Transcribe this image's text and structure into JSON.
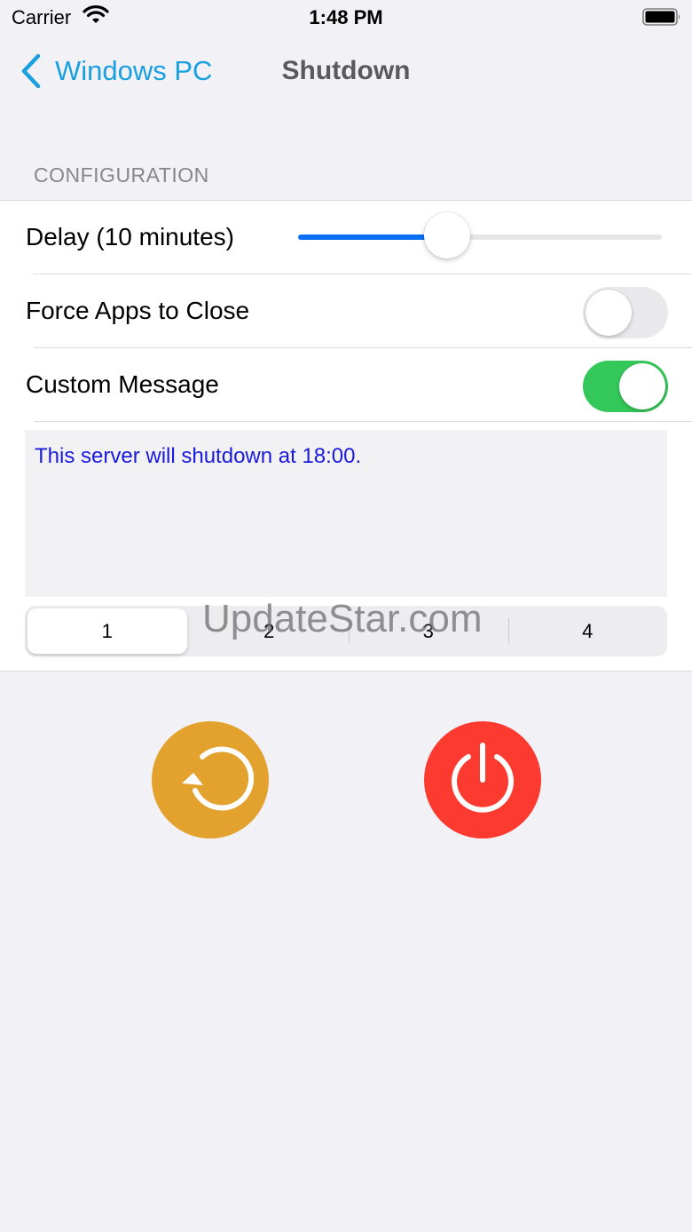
{
  "status_bar": {
    "carrier": "Carrier",
    "time": "1:48 PM",
    "wifi_icon": "wifi-icon",
    "battery_icon": "battery-icon"
  },
  "nav": {
    "back_label": "Windows PC",
    "title": "Shutdown",
    "accent_color": "#1a9fe0"
  },
  "configuration": {
    "header": "CONFIGURATION",
    "delay": {
      "label": "Delay (10 minutes)",
      "slider_value": 0.41,
      "slider_color": "#0a6ff5"
    },
    "force_apps": {
      "label": "Force Apps to Close",
      "enabled": false
    },
    "custom_message": {
      "label": "Custom Message",
      "enabled": true,
      "toggle_color": "#34c759",
      "text": "This server will shutdown at 18:00."
    },
    "segments": {
      "options": [
        "1",
        "2",
        "3",
        "4"
      ],
      "selected_index": 0
    }
  },
  "actions": {
    "restart_color": "#e3a22d",
    "restart_icon": "restart-icon",
    "power_color": "#fd3a2f",
    "power_icon": "power-icon"
  },
  "watermark": "UpdateStar.com"
}
